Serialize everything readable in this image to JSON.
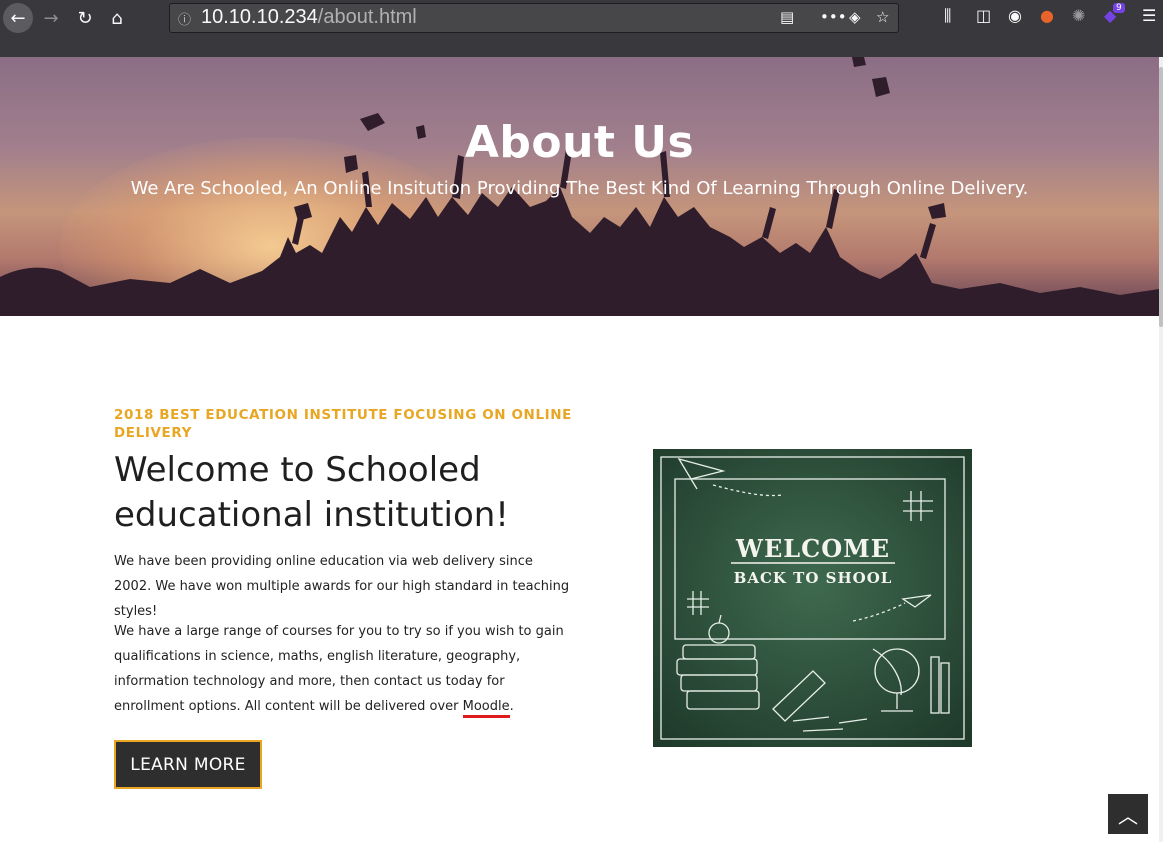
{
  "browser": {
    "url_host": "10.10.10.234",
    "url_path": "/about.html",
    "extension_badge": "9"
  },
  "hero": {
    "title": "About Us",
    "subtitle": "We Are Schooled, An Online Insitution Providing The Best Kind Of Learning Through Online Delivery."
  },
  "about": {
    "kicker": "2018 BEST EDUCATION INSTITUTE FOCUSING ON ONLINE DELIVERY",
    "heading": "Welcome to Schooled educational institution!",
    "paragraph1": "We have been providing online education via web delivery since 2002. We have won multiple awards for our high standard in teaching styles!",
    "paragraph2_start": "We have a large range of courses for you to try so if you wish to gain qualifications in science, maths, english literature, geography, information technology and more, then contact us today for enrollment options. All content will be delivered over ",
    "paragraph2_link": "Moodle",
    "paragraph2_end": ".",
    "button_label": "LEARN MORE"
  },
  "image": {
    "line1": "WELCOME",
    "line2": "BACK TO SHOOL"
  },
  "colors": {
    "accent": "#e8a623",
    "dark": "#2e2e2e",
    "chalkboard": "#2c4a38"
  }
}
